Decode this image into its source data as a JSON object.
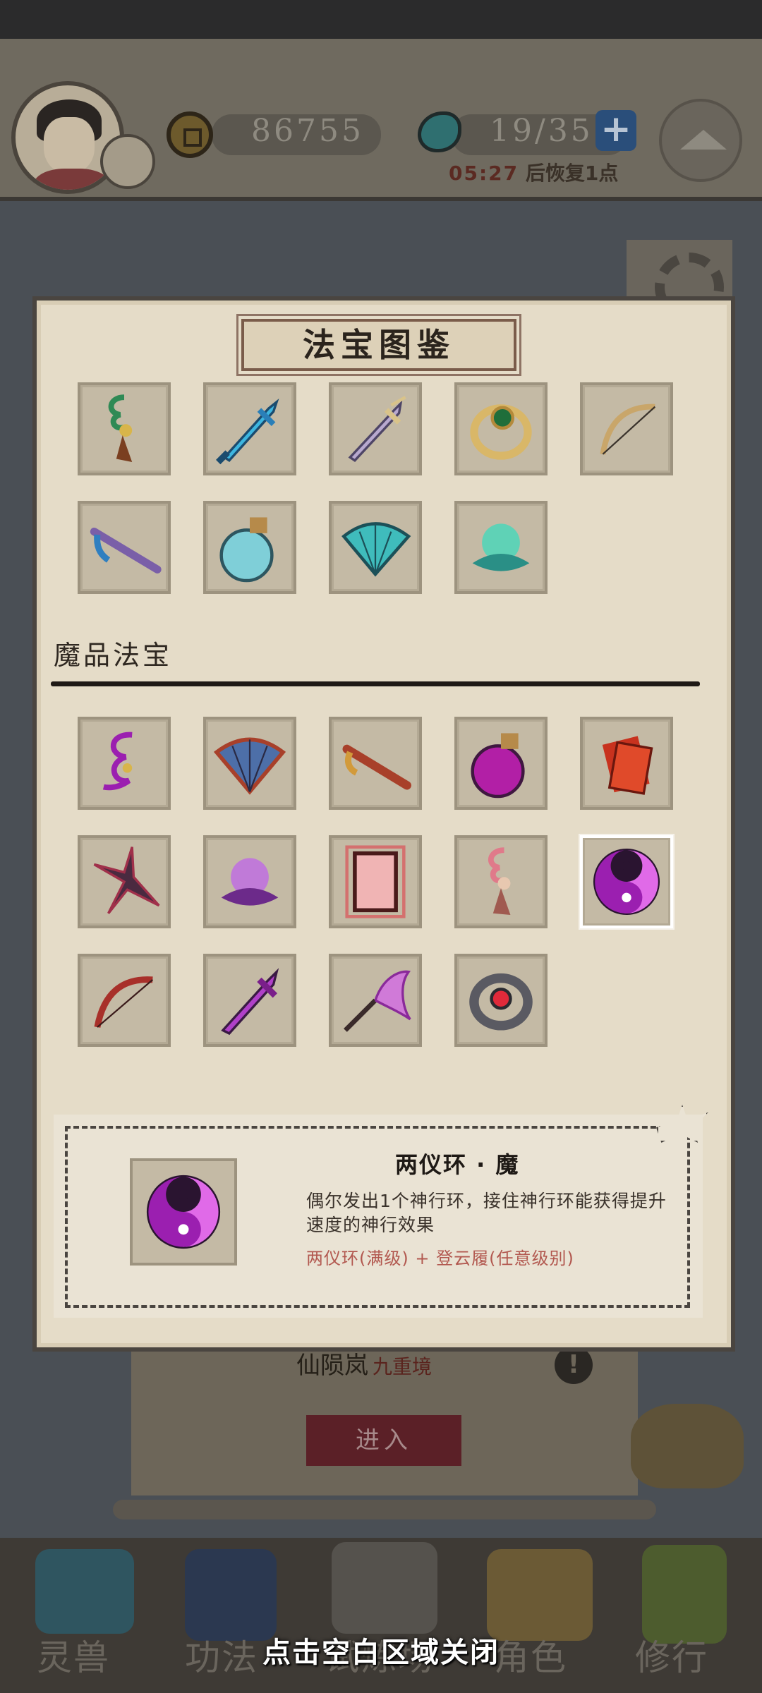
{
  "header": {
    "coins": "86755",
    "stamina": "19/35",
    "recover_time": "05:27",
    "recover_suffix": "后恢复1点",
    "plus_label": "+"
  },
  "background": {
    "realm_name": "仙陨岚",
    "realm_level": "九重境",
    "enter_label": "进入",
    "info_label": "!"
  },
  "bottom_nav": [
    "灵兽",
    "功法",
    "试炼场",
    "角色",
    "修行"
  ],
  "modal": {
    "title": "法宝图鉴",
    "section_label": "魔品法宝",
    "top_items": [
      "jade-pendant-icon",
      "blue-sword-icon",
      "steel-sword-icon",
      "green-ring-icon",
      "bow-icon",
      "flute-icon",
      "blue-gourd-icon",
      "blue-fan-icon",
      "blue-lotus-icon"
    ],
    "demon_items": [
      "purple-rope-icon",
      "red-fan-icon",
      "red-flute-icon",
      "purple-gourd-icon",
      "red-talisman-icon",
      "shuriken-icon",
      "purple-lotus-icon",
      "red-mirror-icon",
      "pink-pendant-icon",
      "yin-yang-ring-icon",
      "red-bow-icon",
      "purple-sword-icon",
      "purple-whisk-icon",
      "red-ring-icon"
    ],
    "selected_item": "yin-yang-ring-icon",
    "detail": {
      "name": "两仪环 · 魔",
      "description": "偶尔发出1个神行环，接住神行环能获得提升速度的神行效果",
      "combo": "两仪环(满级) + 登云履(任意级别)"
    }
  },
  "close_hint": "点击空白区域关闭",
  "colors": {
    "modal_bg": "#e5dcc8",
    "slot_bg": "#c4baa5",
    "combo_text": "#b2584f",
    "magic_purple": "#9b1fb0"
  }
}
